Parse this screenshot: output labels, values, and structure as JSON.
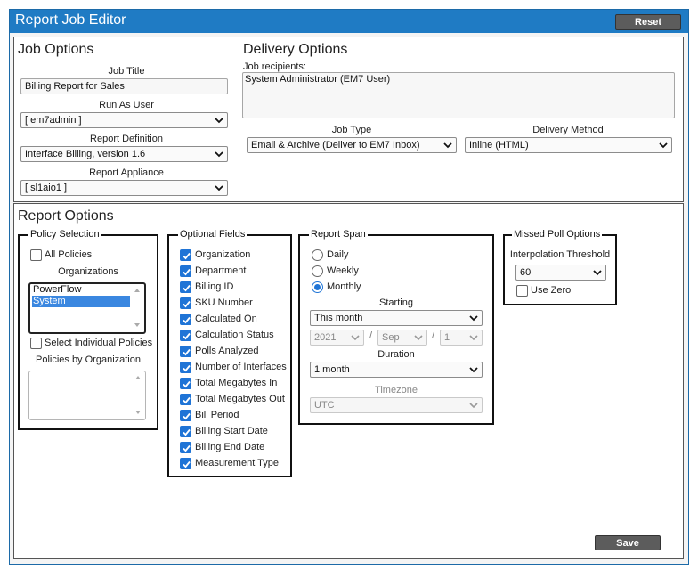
{
  "window": {
    "title": "Report Job Editor",
    "reset_label": "Reset",
    "save_label": "Save"
  },
  "job_options": {
    "title": "Job Options",
    "job_title_label": "Job Title",
    "job_title_value": "Billing Report for Sales",
    "run_as_user_label": "Run As User",
    "run_as_user_value": "[ em7admin ]",
    "report_definition_label": "Report Definition",
    "report_definition_value": "Interface Billing, version 1.6",
    "report_appliance_label": "Report Appliance",
    "report_appliance_value": "[ sl1aio1 ]"
  },
  "delivery_options": {
    "title": "Delivery Options",
    "recipients_label": "Job recipients:",
    "recipients_value": "System Administrator (EM7 User)",
    "job_type_label": "Job Type",
    "job_type_value": "Email & Archive (Deliver to EM7 Inbox)",
    "delivery_method_label": "Delivery Method",
    "delivery_method_value": "Inline (HTML)"
  },
  "report_options": {
    "title": "Report Options",
    "policy_selection": {
      "legend": "Policy Selection",
      "all_policies_label": "All Policies",
      "all_policies_checked": false,
      "organizations_label": "Organizations",
      "organizations": [
        {
          "label": "PowerFlow",
          "selected": false
        },
        {
          "label": "System",
          "selected": true
        }
      ],
      "select_individual_label": "Select Individual Policies",
      "select_individual_checked": false,
      "policies_by_org_label": "Policies by Organization"
    },
    "optional_fields": {
      "legend": "Optional Fields",
      "items": [
        {
          "label": "Organization",
          "checked": true
        },
        {
          "label": "Department",
          "checked": true
        },
        {
          "label": "Billing ID",
          "checked": true
        },
        {
          "label": "SKU Number",
          "checked": true
        },
        {
          "label": "Calculated On",
          "checked": true
        },
        {
          "label": "Calculation Status",
          "checked": true
        },
        {
          "label": "Polls Analyzed",
          "checked": true
        },
        {
          "label": "Number of Interfaces",
          "checked": true
        },
        {
          "label": "Total Megabytes In",
          "checked": true
        },
        {
          "label": "Total Megabytes Out",
          "checked": true
        },
        {
          "label": "Bill Period",
          "checked": true
        },
        {
          "label": "Billing Start Date",
          "checked": true
        },
        {
          "label": "Billing End Date",
          "checked": true
        },
        {
          "label": "Measurement Type",
          "checked": true
        }
      ]
    },
    "report_span": {
      "legend": "Report Span",
      "radios": [
        {
          "label": "Daily",
          "checked": false
        },
        {
          "label": "Weekly",
          "checked": false
        },
        {
          "label": "Monthly",
          "checked": true
        }
      ],
      "starting_label": "Starting",
      "starting_value": "This month",
      "year_value": "2021",
      "month_value": "Sep",
      "day_value": "1",
      "date_separator": "/",
      "duration_label": "Duration",
      "duration_value": "1 month",
      "timezone_label": "Timezone",
      "timezone_value": "UTC"
    },
    "missed_poll": {
      "legend": "Missed Poll Options",
      "threshold_label": "Interpolation Threshold",
      "threshold_value": "60",
      "use_zero_label": "Use Zero",
      "use_zero_checked": false
    }
  },
  "colors": {
    "titlebar": "#1f7bc4",
    "checkbox_accent": "#1f74d6",
    "selected_option": "#3a87e0",
    "dark_button": "#5c5c5c"
  }
}
